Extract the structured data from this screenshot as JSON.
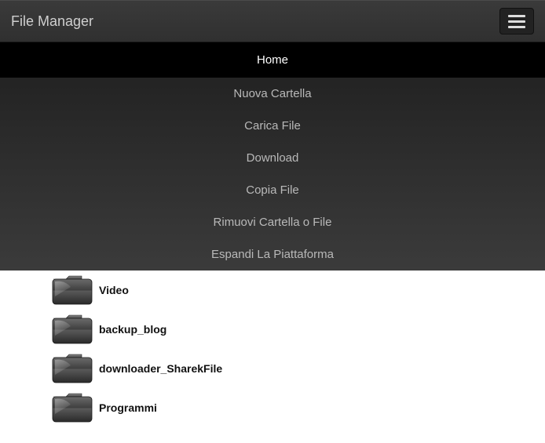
{
  "header": {
    "title": "File Manager"
  },
  "menu": {
    "items": [
      {
        "label": "Home",
        "active": true
      },
      {
        "label": "Nuova Cartella",
        "active": false
      },
      {
        "label": "Carica File",
        "active": false
      },
      {
        "label": "Download",
        "active": false
      },
      {
        "label": "Copia File",
        "active": false
      },
      {
        "label": "Rimuovi Cartella o File",
        "active": false
      },
      {
        "label": "Espandi La Piattaforma",
        "active": false
      }
    ]
  },
  "files": {
    "items": [
      {
        "name": "Video"
      },
      {
        "name": "backup_blog"
      },
      {
        "name": "downloader_SharekFile"
      },
      {
        "name": "Programmi"
      }
    ]
  }
}
